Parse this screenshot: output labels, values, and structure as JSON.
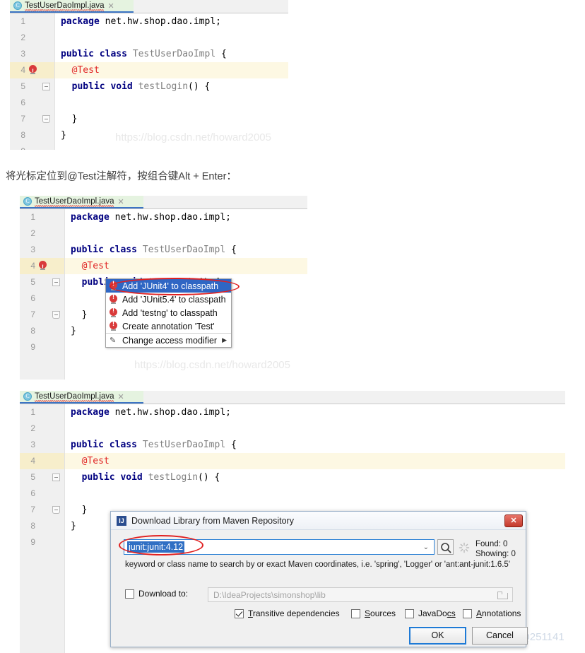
{
  "watermarks": {
    "csdn_howard": "https://blog.csdn.net/howard2005",
    "csdn_qq": "https://blog.csdn.net/QQ251141"
  },
  "caption": "将光标定位到@Test注解符，按组合键Alt + Enter：",
  "editor": {
    "tab": {
      "icon": "java-class-icon",
      "label": "TestUserDaoImpl.java",
      "close": "✕"
    },
    "lines": [
      {
        "no": "1",
        "code_html": "<span class='kw'>package</span> <span class='pl'>net.hw.shop.dao.impl;</span>"
      },
      {
        "no": "2",
        "code_html": ""
      },
      {
        "no": "3",
        "code_html": "<span class='kw'>public class</span> <span class='id'>TestUserDaoImpl</span> <span class='punc'>{</span>"
      },
      {
        "no": "4",
        "code_html": "  <span class='ann'>@Test</span>"
      },
      {
        "no": "5",
        "code_html": "  <span class='kw'>public void</span> <span class='id'>testLogin</span><span class='punc'>() {</span>"
      },
      {
        "no": "6",
        "code_html": ""
      },
      {
        "no": "7",
        "code_html": "  <span class='punc'>}</span>"
      },
      {
        "no": "8",
        "code_html": "<span class='punc'>}</span>"
      },
      {
        "no": "9",
        "code_html": ""
      }
    ]
  },
  "popup": {
    "items": [
      {
        "icon": "bulb-icon",
        "label": "Add 'JUnit4' to classpath",
        "selected": true
      },
      {
        "icon": "bulb-icon",
        "label": "Add 'JUnit5.4' to classpath",
        "selected": false
      },
      {
        "icon": "bulb-icon",
        "label": "Add 'testng' to classpath",
        "selected": false
      },
      {
        "icon": "bulb-icon",
        "label": "Create annotation 'Test'",
        "selected": false
      },
      {
        "icon": "pencil-icon",
        "label": "Change access modifier",
        "selected": false,
        "submenu": true
      }
    ],
    "submenu_arrow": "▶"
  },
  "dialog": {
    "icon": "intellij-idea-icon",
    "icon_text": "IJ",
    "title": "Download Library from Maven Repository",
    "close_label": "✕",
    "search": {
      "value": "junit:junit:4.12",
      "caret": "⌄",
      "search_icon": "magnifier-icon",
      "spinner_icon": "loading-spinner-icon"
    },
    "status": {
      "found": "Found: 0",
      "showing": "Showing: 0"
    },
    "hint": "keyword or class name to search by or exact Maven coordinates, i.e. 'spring', 'Logger' or 'ant:ant-junit:1.6.5'",
    "download_to": {
      "checkbox_label": "Download to:",
      "checked": false,
      "path": "D:\\IdeaProjects\\simonshop\\lib",
      "browse_icon": "folder-icon"
    },
    "options": [
      {
        "label_pre": "T",
        "label_post": "ransitive dependencies",
        "checked": true
      },
      {
        "label_pre": "S",
        "label_post": "ources",
        "checked": false
      },
      {
        "label_pre": "JavaDo",
        "label_post": "cs",
        "checked": false
      },
      {
        "label_pre": "A",
        "label_post": "nnotations",
        "checked": false
      }
    ],
    "buttons": {
      "ok": "OK",
      "cancel": "Cancel"
    }
  }
}
